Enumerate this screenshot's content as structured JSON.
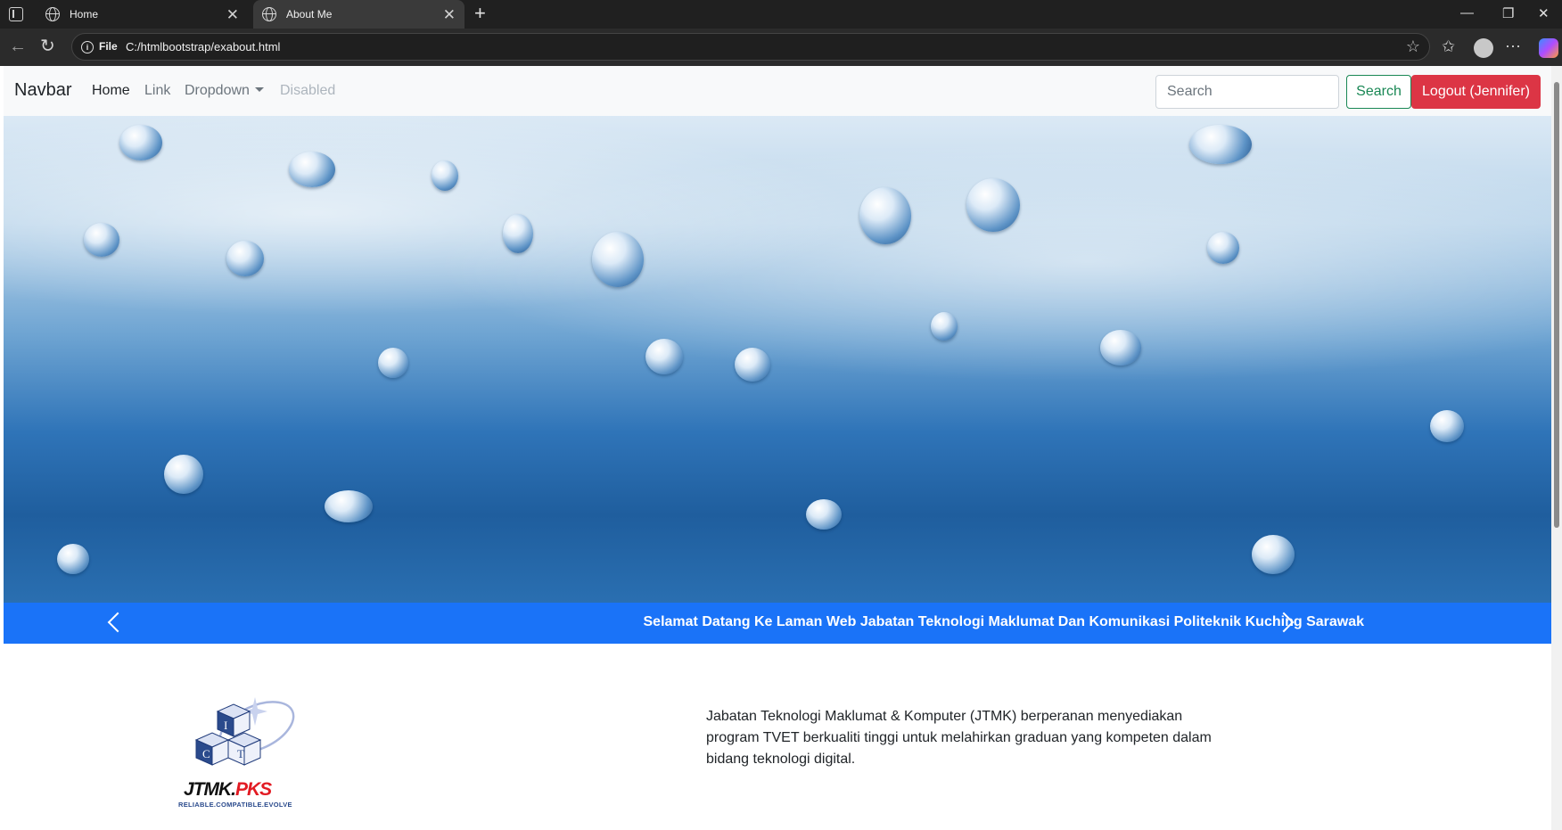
{
  "browser": {
    "tabs": [
      {
        "title": "Home",
        "active": false
      },
      {
        "title": "About Me",
        "active": true
      }
    ],
    "address": {
      "scheme_label": "File",
      "url": "C:/htmlbootstrap/exabout.html"
    }
  },
  "navbar": {
    "brand": "Navbar",
    "links": [
      {
        "label": "Home",
        "state": "active"
      },
      {
        "label": "Link",
        "state": "normal"
      },
      {
        "label": "Dropdown",
        "state": "dropdown"
      },
      {
        "label": "Disabled",
        "state": "disabled"
      }
    ],
    "search_placeholder": "Search",
    "search_button": "Search",
    "logout_button": "Logout (Jennifer)"
  },
  "carousel": {
    "caption": "Selamat Datang Ke Laman Web Jabatan Teknologi Maklumat Dan Komunikasi Politeknik Kuching Sarawak"
  },
  "about": {
    "logo": {
      "letters": [
        "I",
        "C",
        "T"
      ],
      "name_part1": "JTMK.",
      "name_part2": "PKS",
      "tagline": "RELIABLE.COMPATIBLE.EVOLVE"
    },
    "description": "Jabatan Teknologi Maklumat & Komputer (JTMK) berperanan menyediakan program TVET berkualiti tinggi untuk melahirkan graduan yang kompeten dalam bidang teknologi digital."
  },
  "colors": {
    "navbar_bg": "#f8f9fa",
    "success": "#198754",
    "danger": "#dc3545",
    "caption_band": "#1a73f8",
    "logo_red": "#e21b23",
    "logo_blue": "#2a4a8c"
  }
}
